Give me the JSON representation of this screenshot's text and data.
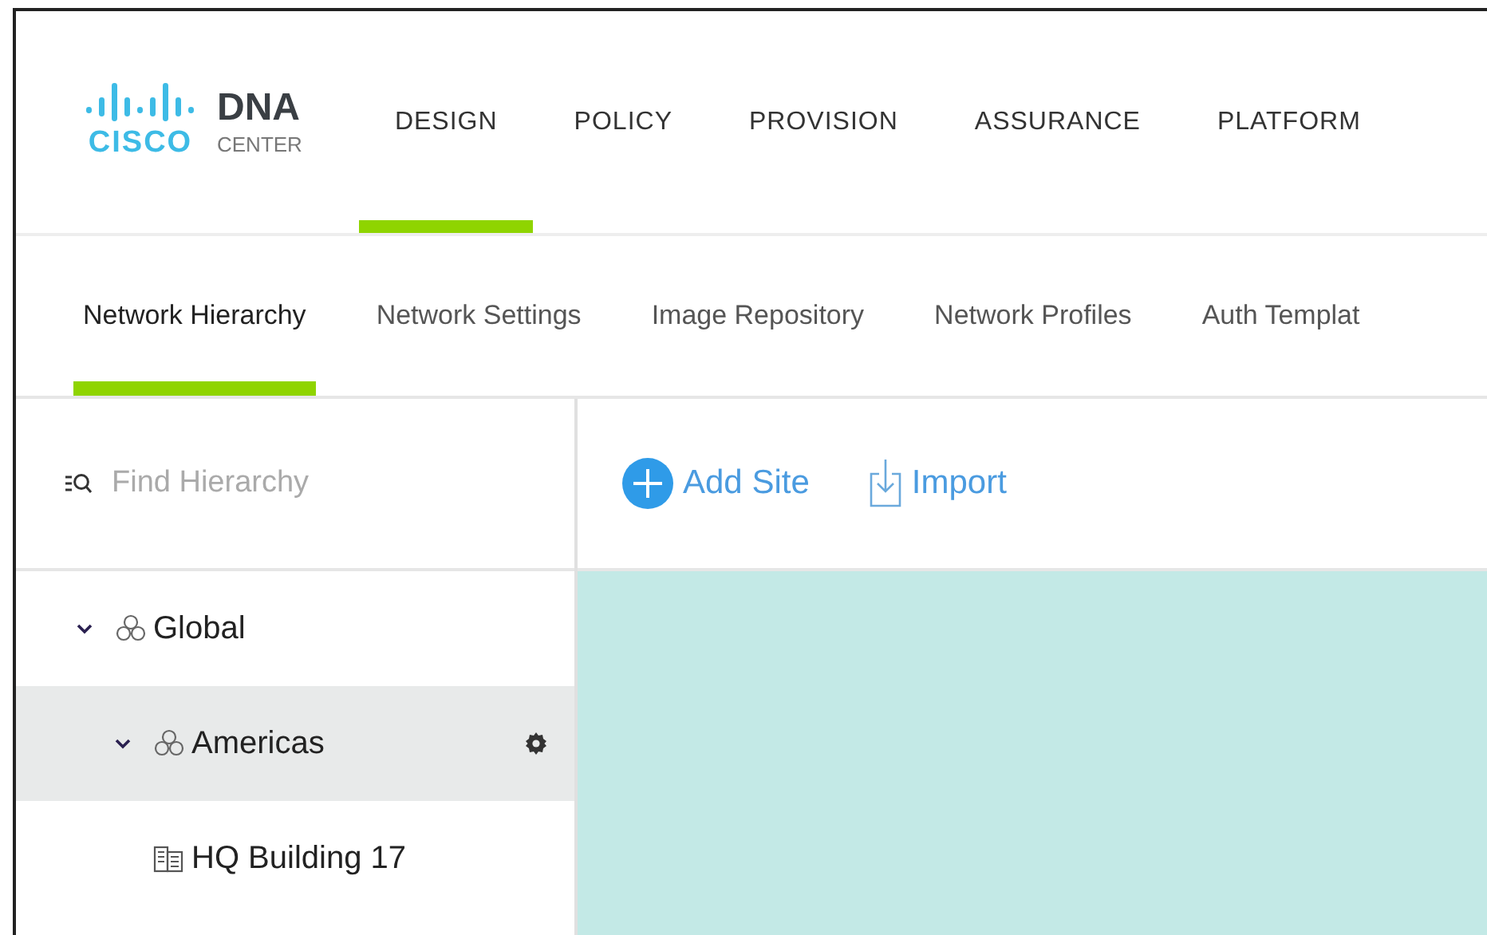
{
  "logo": {
    "brand": "CISCO",
    "product": "DNA",
    "product_sub": "CENTER"
  },
  "main_nav": [
    {
      "label": "DESIGN",
      "selected": true
    },
    {
      "label": "POLICY",
      "selected": false
    },
    {
      "label": "PROVISION",
      "selected": false
    },
    {
      "label": "ASSURANCE",
      "selected": false
    },
    {
      "label": "PLATFORM",
      "selected": false
    }
  ],
  "sub_nav": [
    {
      "label": "Network Hierarchy",
      "selected": true
    },
    {
      "label": "Network Settings",
      "selected": false
    },
    {
      "label": "Image Repository",
      "selected": false
    },
    {
      "label": "Network Profiles",
      "selected": false
    },
    {
      "label": "Auth Templat",
      "selected": false
    }
  ],
  "search": {
    "placeholder": "Find Hierarchy"
  },
  "tree": [
    {
      "label": "Global",
      "kind": "area",
      "expanded": true,
      "selected": false,
      "children": [
        {
          "label": "Americas",
          "kind": "area",
          "expanded": true,
          "selected": true,
          "children": [
            {
              "label": "HQ Building 17",
              "kind": "building",
              "selected": false
            }
          ]
        }
      ]
    }
  ],
  "toolbar": [
    {
      "label": "Add Site",
      "kind": "add"
    },
    {
      "label": "Import",
      "kind": "import"
    }
  ]
}
